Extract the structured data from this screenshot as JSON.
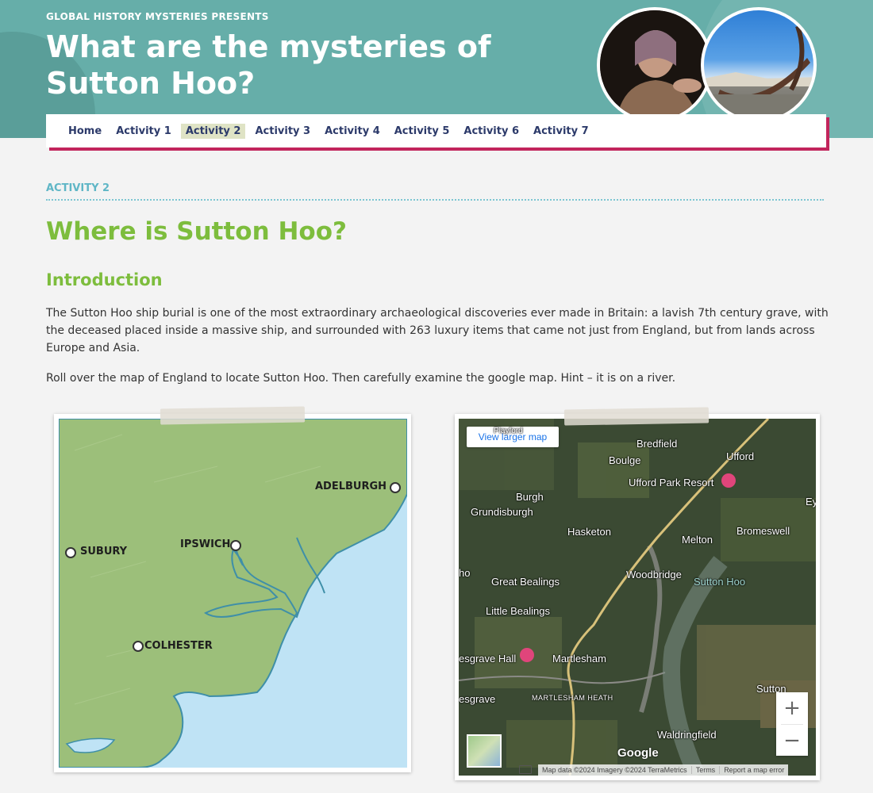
{
  "header": {
    "presents": "GLOBAL HISTORY MYSTERIES PRESENTS",
    "title": "What are the mysteries of Sutton Hoo?"
  },
  "nav": {
    "items": [
      "Home",
      "Activity 1",
      "Activity 2",
      "Activity 3",
      "Activity 4",
      "Activity 5",
      "Activity 6",
      "Activity 7"
    ],
    "active": "Activity 2"
  },
  "content": {
    "kicker": "ACTIVITY 2",
    "title": "Where is Sutton Hoo?",
    "intro_heading": "Introduction",
    "para1": "The Sutton Hoo ship burial is one of the most extraordinary archaeological discoveries ever made in Britain: a lavish 7th century grave, with the deceased placed inside a massive ship, and surrounded with 263 luxury items that came not just from England, but from lands across Europe and Asia.",
    "para2": "Roll over the map of England to locate Sutton Hoo. Then carefully examine the google map. Hint – it is on a river."
  },
  "illustrated_map": {
    "towns": [
      "ADELBURGH",
      "SUBURY",
      "IPSWICH",
      "COLHESTER"
    ],
    "colors": {
      "land": "#9cbf7a",
      "sea": "#bfe3f5",
      "coast": "#3f8fa8"
    }
  },
  "google_map": {
    "larger_map_label": "View larger map",
    "places": [
      "Bredfield",
      "Boulge",
      "Ufford",
      "Ufford Park Resort",
      "Burgh",
      "Grundisburgh",
      "Hasketon",
      "Melton",
      "Bromeswell",
      "Woodbridge",
      "Sutton Hoo",
      "Great Bealings",
      "Little Bealings",
      "Martlesham",
      "Sutton",
      "Waldringfield",
      "MARTLESHAM HEATH",
      "Playford",
      "Ey",
      "esgrave Hall",
      "esgrave",
      "ho"
    ],
    "logo": "Google",
    "attribution": [
      "Map data ©2024 Imagery ©2024 TerraMetrics",
      "Terms",
      "Report a map error"
    ],
    "zoom_in": "+",
    "zoom_out": "−"
  }
}
